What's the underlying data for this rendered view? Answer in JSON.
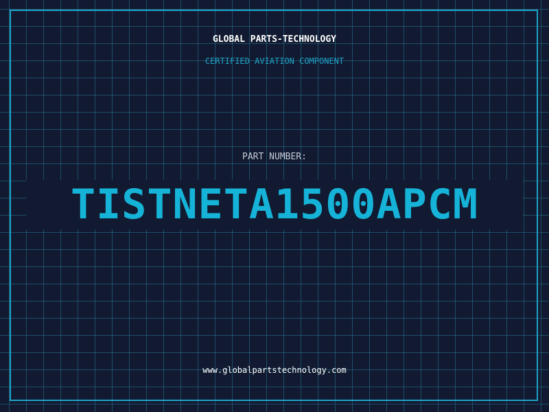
{
  "header": {
    "company": "GLOBAL PARTS-TECHNOLOGY",
    "subtitle": "CERTIFIED AVIATION COMPONENT"
  },
  "part": {
    "label": "PART NUMBER:",
    "number": "TISTNETA1500APCM"
  },
  "footer": {
    "website": "www.globalpartstechnology.com"
  },
  "colors": {
    "background": "#111a30",
    "grid": "#28789a",
    "accent": "#16b3d8",
    "frame": "#1fa3c9",
    "text": "#ffffff",
    "label": "#c7ccd8"
  }
}
